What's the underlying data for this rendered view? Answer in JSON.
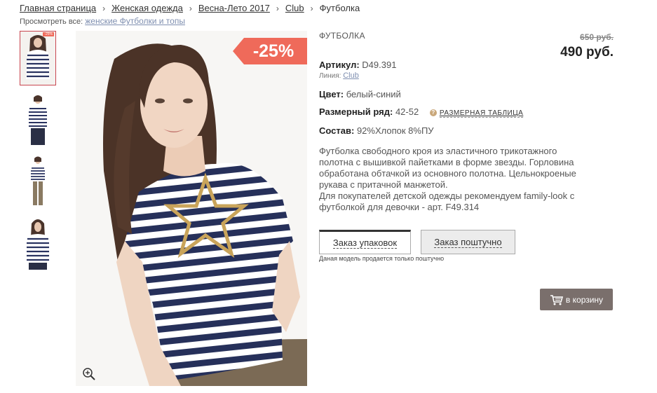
{
  "breadcrumb": {
    "items": [
      "Главная страница",
      "Женская одежда",
      "Весна-Лето 2017",
      "Club"
    ],
    "current": "Футболка",
    "separator": "›"
  },
  "view_all": {
    "label": "Просмотреть все:",
    "link": "женские Футболки и топы"
  },
  "gallery": {
    "thumbnails": [
      "photo-1",
      "photo-2",
      "photo-3",
      "photo-4"
    ],
    "active_thumbnail": 0,
    "thumb_badge": "-25%",
    "discount_badge": "-25%"
  },
  "product": {
    "type": "ФУТБОЛКА",
    "old_price": "650 руб.",
    "price": "490 руб.",
    "article_label": "Артикул:",
    "article_value": "D49.391",
    "line_label": "Линия:",
    "line_value": "Club",
    "color_label": "Цвет:",
    "color_value": "белый-синий",
    "size_label": "Размерный ряд:",
    "size_value": "42-52",
    "size_table_link": "РАЗМЕРНАЯ ТАБЛИЦА",
    "composition_label": "Состав:",
    "composition_value": "92%Хлопок 8%ПУ",
    "description": "Футболка свободного кроя из эластичного трикотажного\nполотна с вышивкой пайетками в форме звезды. Горловина\nобработана обтачкой из основного полотна. Цельнокроеные\nрукава с притачной манжетой.\nДля покупателей детской одежды рекомендуем family-look с\nфутболкой для девочки - арт. F49.314"
  },
  "order": {
    "tab_pack": "Заказ упаковок",
    "tab_piece": "Заказ поштучно",
    "note": "Даная модель продается только поштучно",
    "cart_button": "в корзину"
  },
  "colors": {
    "accent": "#ef6a5a",
    "cart_bg": "#7a6f6c",
    "link": "#7f8fb0",
    "active_border": "#c8454f"
  }
}
